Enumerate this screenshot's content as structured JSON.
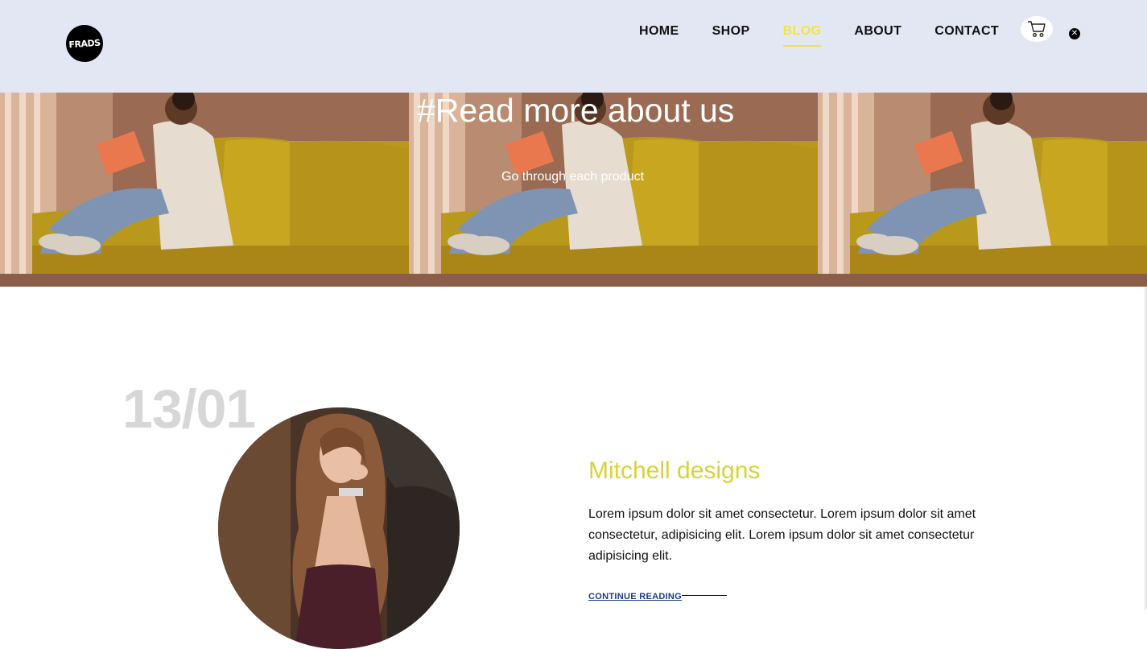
{
  "brand": {
    "logo_text": "FRADS"
  },
  "nav": {
    "items": [
      {
        "label": "HOME",
        "active": false
      },
      {
        "label": "SHOP",
        "active": false
      },
      {
        "label": "BLOG",
        "active": true
      },
      {
        "label": "ABOUT",
        "active": false
      },
      {
        "label": "CONTACT",
        "active": false
      }
    ],
    "cart_icon": "cart-icon",
    "close_icon": "close-icon"
  },
  "hero": {
    "title": "#Read more about us",
    "subtitle": "Go through each product"
  },
  "post": {
    "date": "13/01",
    "title": "Mitchell designs",
    "body": "Lorem ipsum dolor sit amet consectetur. Lorem ipsum dolor sit amet consectetur, adipisicing elit. Lorem ipsum dolor sit amet consectetur adipisicing elit.",
    "cta": "CONTINUE READING"
  },
  "colors": {
    "header_bg": "#e3e7f4",
    "accent_yellow": "#f3e53a",
    "post_title": "#d9d33a",
    "cta_blue": "#1d3d8a",
    "date_gray": "#d7d7d7"
  }
}
